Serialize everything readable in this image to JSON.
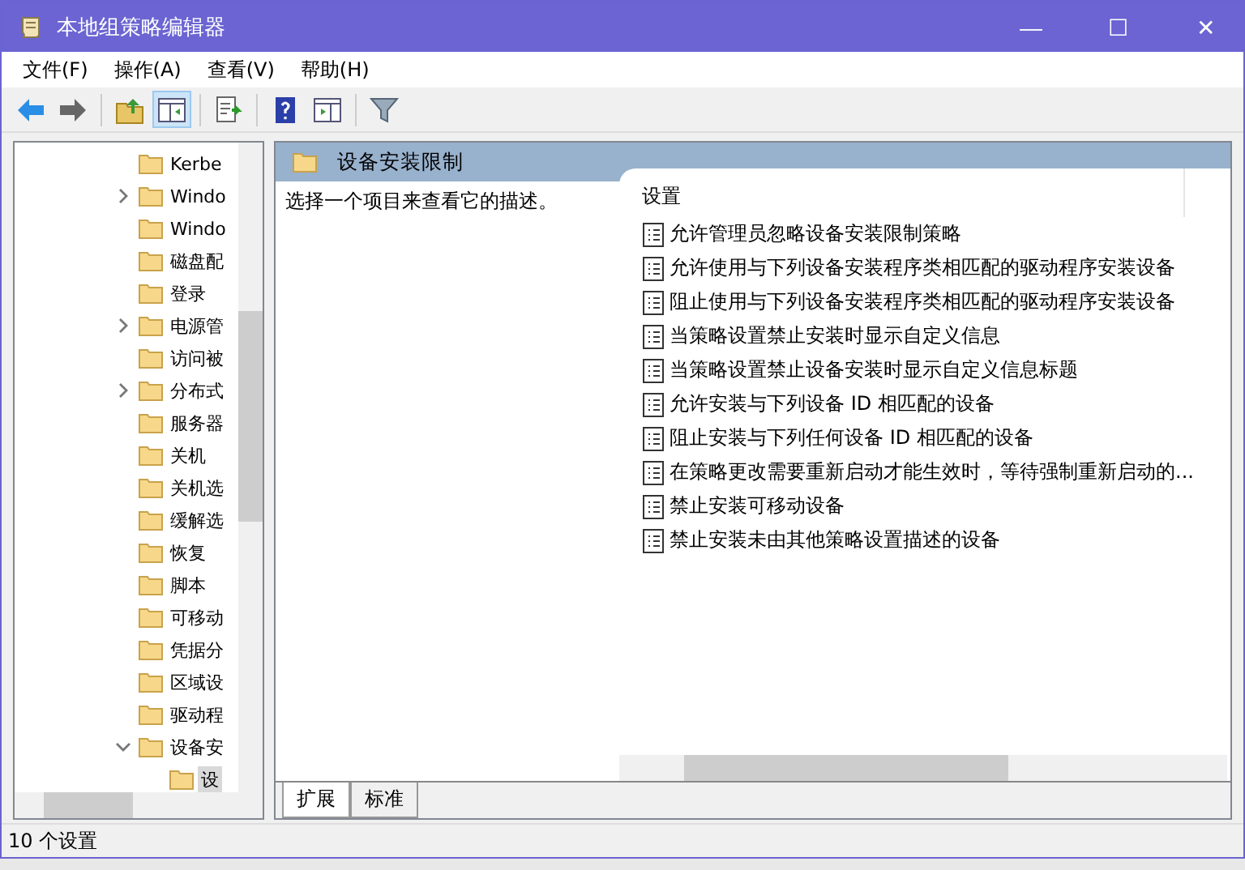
{
  "window": {
    "title": "本地组策略编辑器",
    "controls": [
      "—",
      "☐",
      "✕"
    ]
  },
  "menu": [
    "文件(F)",
    "操作(A)",
    "查看(V)",
    "帮助(H)"
  ],
  "toolbar": [
    {
      "kind": "back",
      "pressed": false
    },
    {
      "kind": "forward",
      "pressed": false
    },
    {
      "kind": "sep"
    },
    {
      "kind": "up",
      "pressed": false
    },
    {
      "kind": "tree",
      "pressed": true
    },
    {
      "kind": "sep"
    },
    {
      "kind": "export",
      "pressed": false
    },
    {
      "kind": "sep"
    },
    {
      "kind": "help",
      "pressed": false
    },
    {
      "kind": "pane",
      "pressed": false
    },
    {
      "kind": "sep"
    },
    {
      "kind": "filter",
      "pressed": false
    }
  ],
  "tree": [
    {
      "label": "Kerbe",
      "selected": false
    },
    {
      "label": "Windo",
      "expanded": false,
      "selected": false
    },
    {
      "label": "Windo",
      "selected": false
    },
    {
      "label": "磁盘配",
      "selected": false
    },
    {
      "label": "登录",
      "selected": false
    },
    {
      "label": "电源管",
      "expanded": false,
      "selected": false
    },
    {
      "label": "访问被",
      "selected": false
    },
    {
      "label": "分布式",
      "expanded": false,
      "selected": false
    },
    {
      "label": "服务器",
      "selected": false
    },
    {
      "label": "关机",
      "selected": false
    },
    {
      "label": "关机选",
      "selected": false
    },
    {
      "label": "缓解选",
      "selected": false
    },
    {
      "label": "恢复",
      "selected": false
    },
    {
      "label": "脚本",
      "selected": false
    },
    {
      "label": "可移动",
      "selected": false
    },
    {
      "label": "凭据分",
      "selected": false
    },
    {
      "label": "区域设",
      "selected": false
    },
    {
      "label": "驱动程",
      "selected": false
    },
    {
      "label": "设备安",
      "expanded": true,
      "selected": false,
      "children": [
        {
          "label": "设",
          "selected": true
        }
      ]
    }
  ],
  "pane": {
    "title": "设备安装限制",
    "description": "选择一个项目来查看它的描述。",
    "column": "设置",
    "settings": [
      "允许管理员忽略设备安装限制策略",
      "允许使用与下列设备安装程序类相匹配的驱动程序安装设备",
      "阻止使用与下列设备安装程序类相匹配的驱动程序安装设备",
      "当策略设置禁止安装时显示自定义信息",
      "当策略设置禁止设备安装时显示自定义信息标题",
      "允许安装与下列设备 ID 相匹配的设备",
      "阻止安装与下列任何设备 ID 相匹配的设备",
      "在策略更改需要重新启动才能生效时，等待强制重新启动的...",
      "禁止安装可移动设备",
      "禁止安装未由其他策略设置描述的设备"
    ]
  },
  "tabs": [
    {
      "label": "扩展",
      "selected": true
    },
    {
      "label": "标准",
      "selected": false
    }
  ],
  "status_bar": "10 个设置"
}
